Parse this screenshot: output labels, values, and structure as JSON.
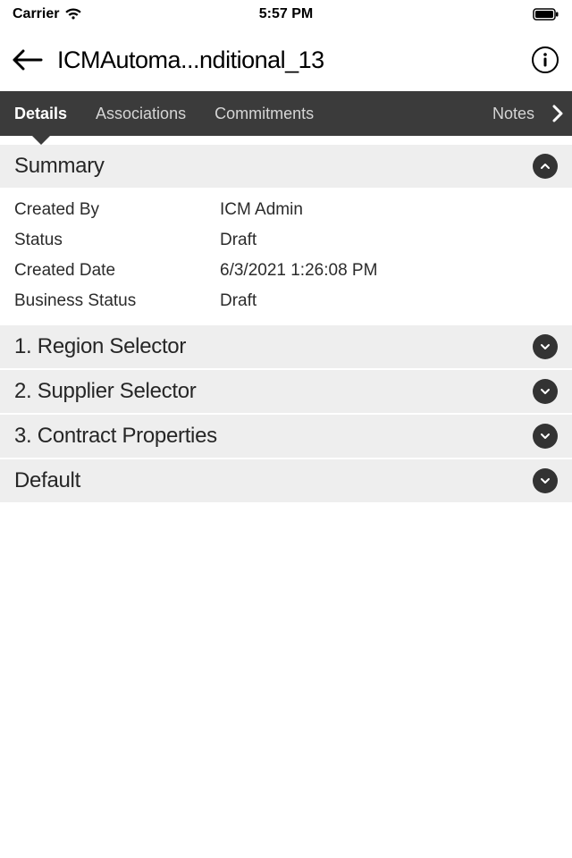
{
  "statusbar": {
    "carrier": "Carrier",
    "time": "5:57 PM"
  },
  "header": {
    "title": "ICMAutoma...nditional_13"
  },
  "tabs": {
    "items": [
      {
        "label": "Details"
      },
      {
        "label": "Associations"
      },
      {
        "label": "Commitments"
      },
      {
        "label": "Notes"
      }
    ],
    "activeIndex": 0
  },
  "sections": {
    "summary": {
      "title": "Summary",
      "expanded": true,
      "rows": [
        {
          "label": "Created By",
          "value": "ICM Admin"
        },
        {
          "label": "Status",
          "value": "Draft"
        },
        {
          "label": "Created Date",
          "value": "6/3/2021 1:26:08 PM"
        },
        {
          "label": "Business Status",
          "value": "Draft"
        }
      ]
    },
    "collapsed": [
      {
        "title": "1. Region Selector"
      },
      {
        "title": "2. Supplier Selector"
      },
      {
        "title": "3. Contract Properties"
      },
      {
        "title": "Default"
      }
    ]
  }
}
